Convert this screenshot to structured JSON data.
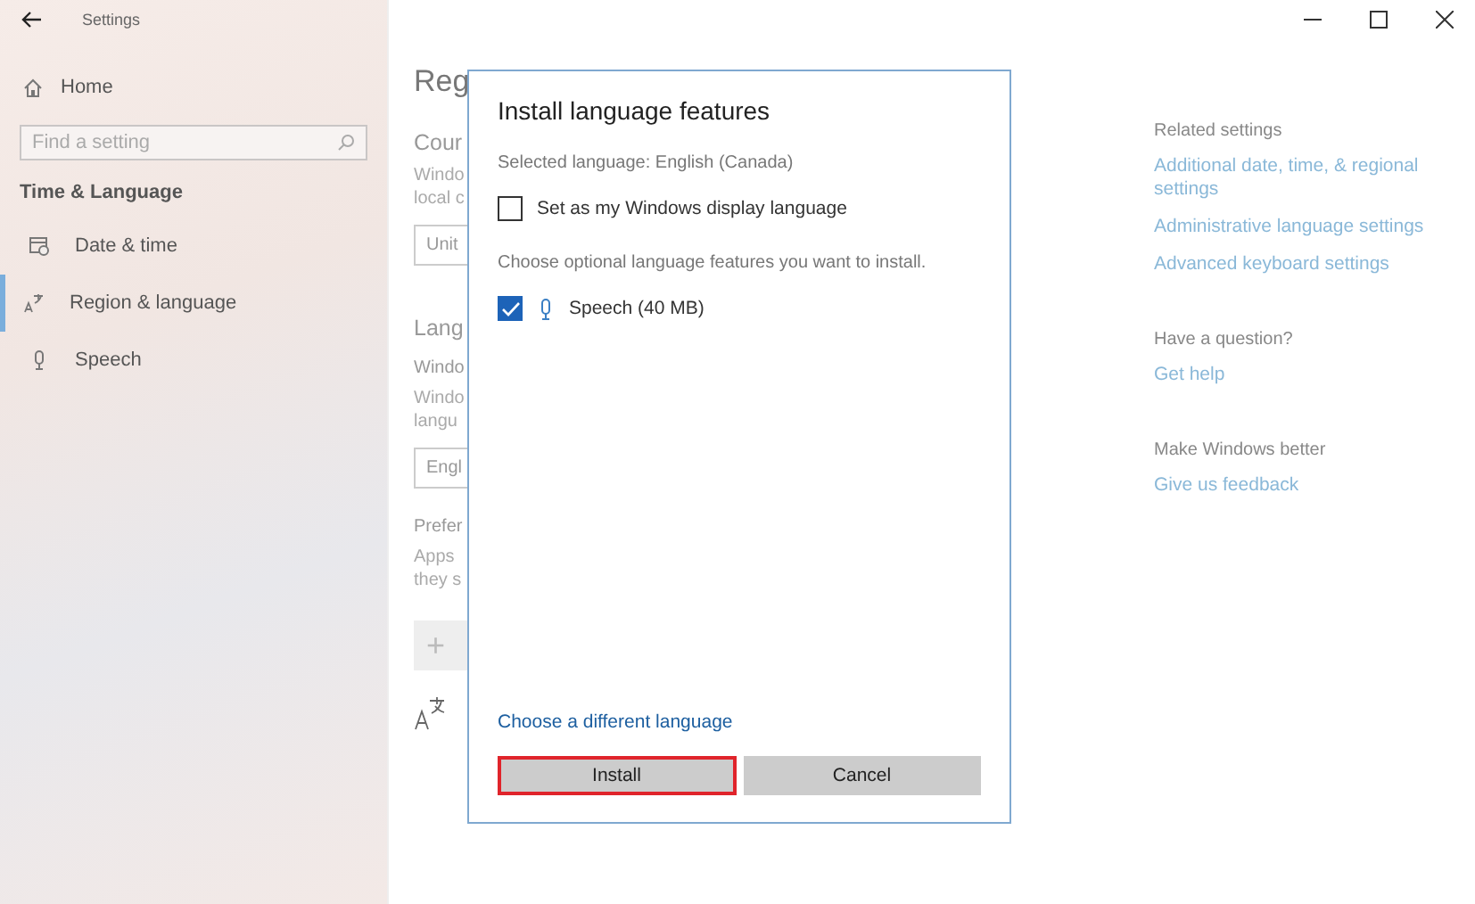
{
  "window": {
    "title": "Settings"
  },
  "sidebar": {
    "home": "Home",
    "search": {
      "placeholder": "Find a setting"
    },
    "section": "Time & Language",
    "items": [
      {
        "label": "Date & time",
        "kind": "calendar",
        "selected": false
      },
      {
        "label": "Region & language",
        "kind": "language",
        "selected": true
      },
      {
        "label": "Speech",
        "kind": "microphone",
        "selected": false
      }
    ]
  },
  "page": {
    "title": "Reg",
    "country_heading": "Cour",
    "country_text": [
      "Windo",
      "local c"
    ],
    "country_value": "Unit",
    "language_heading": "Lang",
    "display_label": "Windo",
    "display_text": [
      "Windo",
      "langu"
    ],
    "display_value": "Engl",
    "preferred_label": "Prefer",
    "preferred_text": [
      "Apps",
      "they s"
    ],
    "add_button": "+"
  },
  "related": {
    "heading": "Related settings",
    "links": [
      "Additional date, time, & regional settings",
      "Administrative language settings",
      "Advanced keyboard settings"
    ],
    "question": "Have a question?",
    "help_link": "Get help",
    "better": "Make Windows better",
    "feedback_link": "Give us feedback"
  },
  "dialog": {
    "title": "Install language features",
    "selected_language": "Selected language: English (Canada)",
    "display_option": {
      "label": "Set as my Windows display language",
      "checked": false
    },
    "features_prompt": "Choose optional language features you want to install.",
    "features": [
      {
        "label": "Speech (40 MB)",
        "checked": true
      }
    ],
    "link": "Choose a different language",
    "buttons": [
      {
        "label": "Install",
        "highlighted": true
      },
      {
        "label": "Cancel",
        "highlighted": false
      }
    ]
  }
}
